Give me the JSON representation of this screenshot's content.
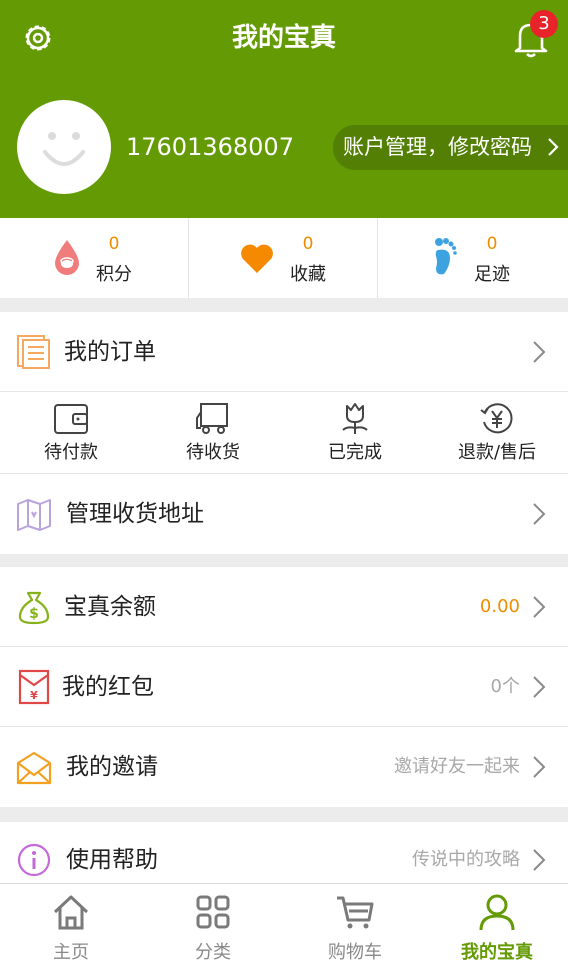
{
  "header": {
    "title": "我的宝真",
    "notification_count": "3",
    "phone": "17601368007",
    "account_link": "账户管理，修改密码"
  },
  "stats": [
    {
      "value": "0",
      "label": "积分",
      "icon": "points-drop-icon"
    },
    {
      "value": "0",
      "label": "收藏",
      "icon": "heart-icon"
    },
    {
      "value": "0",
      "label": "足迹",
      "icon": "footprint-icon"
    }
  ],
  "orders": {
    "title": "我的订单",
    "statuses": [
      {
        "label": "待付款",
        "icon": "wallet-icon"
      },
      {
        "label": "待收货",
        "icon": "truck-icon"
      },
      {
        "label": "已完成",
        "icon": "flower-icon"
      },
      {
        "label": "退款/售后",
        "icon": "refund-yen-icon"
      }
    ],
    "address": "管理收货地址"
  },
  "finance": {
    "balance_label": "宝真余额",
    "balance_value": "0.00",
    "redpacket_label": "我的红包",
    "redpacket_value": "0个",
    "invite_label": "我的邀请",
    "invite_value": "邀请好友一起来"
  },
  "help": {
    "label": "使用帮助",
    "value": "传说中的攻略"
  },
  "tabbar": [
    {
      "label": "主页",
      "icon": "home-icon"
    },
    {
      "label": "分类",
      "icon": "grid-icon"
    },
    {
      "label": "购物车",
      "icon": "cart-icon"
    },
    {
      "label": "我的宝真",
      "icon": "user-icon"
    }
  ],
  "colors": {
    "brand_green": "#649b05",
    "accent_orange": "#f08c00",
    "badge_red": "#e8232a"
  }
}
